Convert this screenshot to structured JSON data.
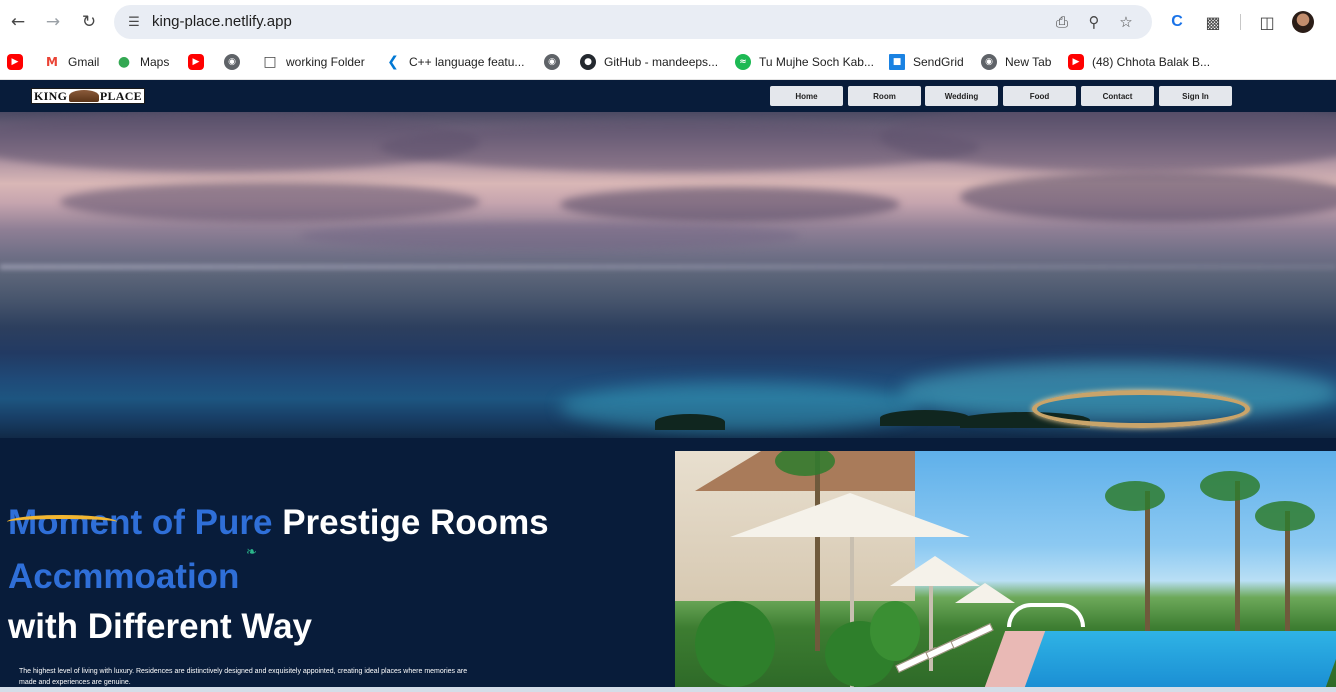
{
  "browser": {
    "url": "king-place.netlify.app",
    "bookmarks": [
      {
        "label": "",
        "icon": "youtube-icon"
      },
      {
        "label": "Gmail",
        "icon": "gmail-icon"
      },
      {
        "label": "Maps",
        "icon": "maps-icon"
      },
      {
        "label": "",
        "icon": "youtube-icon"
      },
      {
        "label": "",
        "icon": "globe-icon"
      },
      {
        "label": "working Folder",
        "icon": "folder-icon"
      },
      {
        "label": "C++ language featu...",
        "icon": "vscode-icon"
      },
      {
        "label": "",
        "icon": "globe-icon"
      },
      {
        "label": "GitHub - mandeeps...",
        "icon": "github-icon"
      },
      {
        "label": "Tu Mujhe Soch Kab...",
        "icon": "spotify-icon"
      },
      {
        "label": "SendGrid",
        "icon": "sendgrid-icon"
      },
      {
        "label": "New Tab",
        "icon": "globe-icon"
      },
      {
        "label": "(48) Chhota Balak B...",
        "icon": "youtube-icon"
      }
    ]
  },
  "site": {
    "logo_left": "KING",
    "logo_right": "PLACE",
    "nav": [
      "Home",
      "Room",
      "Wedding",
      "Food",
      "Contact",
      "Sign In"
    ],
    "headline": {
      "line1_blue": "Moment of Pure",
      "line1_white": "Prestige Rooms",
      "line2_blue": "Accmmoation",
      "line3_white": "with Different Way"
    },
    "description": "The highest level of living with luxury. Residences are distinctively designed and exquisitely appointed, creating ideal places where memories are made and experiences are genuine."
  },
  "colors": {
    "nav_bg": "#081c3a",
    "headline_blue": "#2f6fd8",
    "accent_stroke": "#f2b631",
    "nav_button": "#e4e7ec"
  }
}
